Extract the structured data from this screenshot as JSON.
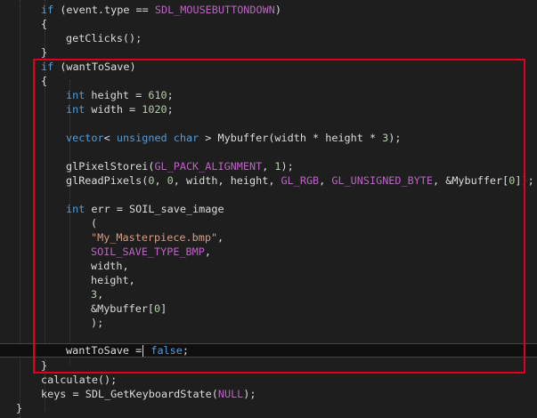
{
  "lines": [
    {
      "parts": [
        {
          "t": "if",
          "c": "kw"
        },
        {
          "t": " (event.type == "
        },
        {
          "t": "SDL_MOUSEBUTTONDOWN",
          "c": "mac"
        },
        {
          "t": ")"
        }
      ]
    },
    {
      "parts": [
        {
          "t": "{"
        }
      ]
    },
    {
      "parts": [
        {
          "t": "getClicks();"
        }
      ]
    },
    {
      "parts": [
        {
          "t": "}"
        }
      ]
    },
    {
      "parts": [
        {
          "t": "if",
          "c": "kw"
        },
        {
          "t": " (wantToSave)"
        }
      ]
    },
    {
      "parts": [
        {
          "t": "{"
        }
      ]
    },
    {
      "parts": [
        {
          "t": "int",
          "c": "kw"
        },
        {
          "t": " height = "
        },
        {
          "t": "610",
          "c": "num"
        },
        {
          "t": ";"
        }
      ]
    },
    {
      "parts": [
        {
          "t": "int",
          "c": "kw"
        },
        {
          "t": " width = "
        },
        {
          "t": "1020",
          "c": "num"
        },
        {
          "t": ";"
        }
      ]
    },
    {
      "parts": []
    },
    {
      "parts": [
        {
          "t": "vector",
          "c": "kw"
        },
        {
          "t": "< "
        },
        {
          "t": "unsigned",
          "c": "kw"
        },
        {
          "t": " "
        },
        {
          "t": "char",
          "c": "kw"
        },
        {
          "t": " > Mybuffer(width * height * "
        },
        {
          "t": "3",
          "c": "num"
        },
        {
          "t": ");"
        }
      ]
    },
    {
      "parts": []
    },
    {
      "parts": [
        {
          "t": "glPixelStorei("
        },
        {
          "t": "GL_PACK_ALIGNMENT",
          "c": "mac"
        },
        {
          "t": ", "
        },
        {
          "t": "1",
          "c": "num"
        },
        {
          "t": ");"
        }
      ]
    },
    {
      "parts": [
        {
          "t": "glReadPixels("
        },
        {
          "t": "0",
          "c": "num"
        },
        {
          "t": ", "
        },
        {
          "t": "0",
          "c": "num"
        },
        {
          "t": ", width, height, "
        },
        {
          "t": "GL_RGB",
          "c": "mac"
        },
        {
          "t": ", "
        },
        {
          "t": "GL_UNSIGNED_BYTE",
          "c": "mac"
        },
        {
          "t": ", &Mybuffer["
        },
        {
          "t": "0",
          "c": "num"
        },
        {
          "t": "]);"
        }
      ]
    },
    {
      "parts": []
    },
    {
      "parts": [
        {
          "t": "int",
          "c": "kw"
        },
        {
          "t": " err = SOIL_save_image"
        }
      ]
    },
    {
      "parts": [
        {
          "t": "("
        }
      ]
    },
    {
      "parts": [
        {
          "t": "\"My_Masterpiece.bmp\"",
          "c": "str"
        },
        {
          "t": ","
        }
      ]
    },
    {
      "parts": [
        {
          "t": "SOIL_SAVE_TYPE_BMP",
          "c": "mac"
        },
        {
          "t": ","
        }
      ]
    },
    {
      "parts": [
        {
          "t": "width,"
        }
      ]
    },
    {
      "parts": [
        {
          "t": "height,"
        }
      ]
    },
    {
      "parts": [
        {
          "t": "3",
          "c": "num"
        },
        {
          "t": ","
        }
      ]
    },
    {
      "parts": [
        {
          "t": "&Mybuffer["
        },
        {
          "t": "0",
          "c": "num"
        },
        {
          "t": "]"
        }
      ]
    },
    {
      "parts": [
        {
          "t": ");"
        }
      ]
    },
    {
      "parts": []
    },
    {
      "parts": [
        {
          "t": "wantToSave ="
        },
        {
          "caret": true
        },
        {
          "t": " "
        },
        {
          "t": "false",
          "c": "kw"
        },
        {
          "t": ";"
        }
      ]
    },
    {
      "parts": [
        {
          "t": "}"
        }
      ]
    },
    {
      "parts": [
        {
          "t": "calculate();"
        }
      ]
    },
    {
      "parts": [
        {
          "t": "keys = SDL_GetKeyboardState("
        },
        {
          "t": "NULL",
          "c": "mac"
        },
        {
          "t": ");"
        }
      ]
    },
    {
      "parts": [
        {
          "t": "}"
        }
      ]
    }
  ]
}
